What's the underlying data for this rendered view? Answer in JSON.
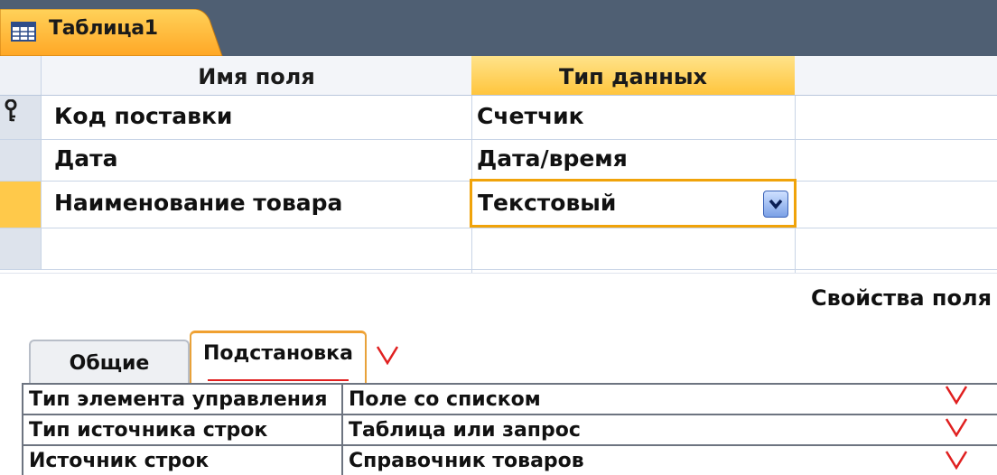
{
  "document_tab": {
    "title": "Таблица1",
    "icon": "table-icon"
  },
  "grid": {
    "headers": {
      "field_name": "Имя поля",
      "data_type": "Тип данных"
    },
    "rows": [
      {
        "field": "Код поставки",
        "type": "Счетчик",
        "primary_key": true
      },
      {
        "field": "Дата",
        "type": "Дата/время"
      },
      {
        "field": "Наименование товара",
        "type": "Текстовый",
        "current": true
      }
    ]
  },
  "properties": {
    "title": "Свойства поля",
    "tabs": [
      {
        "label": "Общие",
        "active": false
      },
      {
        "label": "Подстановка",
        "active": true
      }
    ],
    "items": [
      {
        "name": "Тип элемента управления",
        "value": "Поле со списком"
      },
      {
        "name": "Тип источника строк",
        "value": "Таблица или запрос"
      },
      {
        "name": "Источник строк",
        "value": "Справочник товаров"
      }
    ]
  },
  "colors": {
    "tabbar_bg": "#4f5f73",
    "tab_orange": "#ffb733",
    "active_header": "#ffc53d",
    "selector_bg": "#dde3ec",
    "annotation_red": "#e02020"
  }
}
